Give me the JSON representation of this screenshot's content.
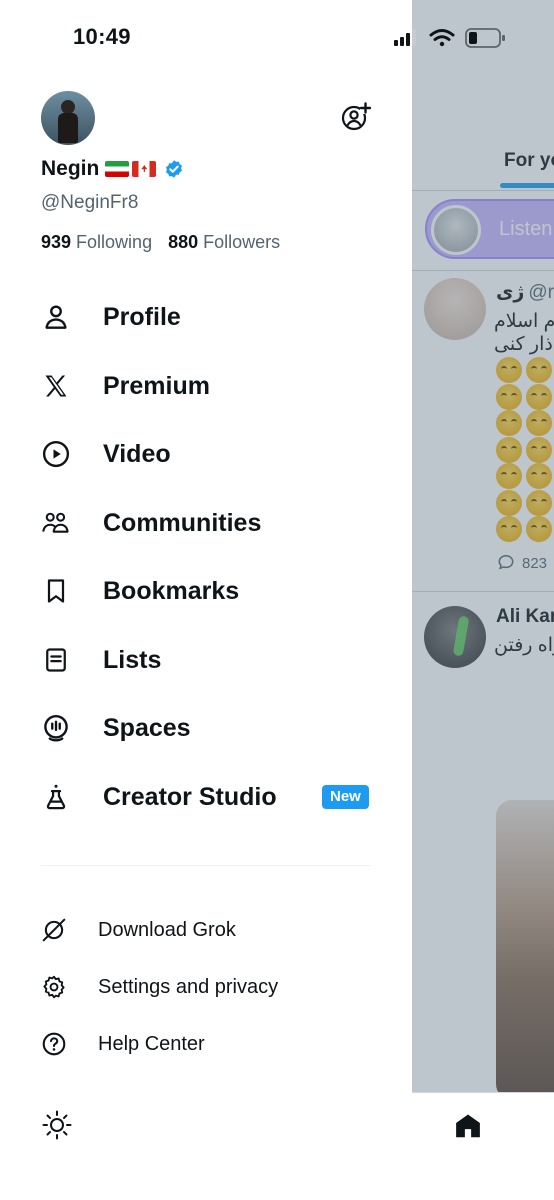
{
  "status_bar": {
    "time": "10:49"
  },
  "profile": {
    "name": "Negin",
    "handle": "@NeginFr8",
    "following_count": "939",
    "following_label": "Following",
    "followers_count": "880",
    "followers_label": "Followers"
  },
  "menu": [
    {
      "label": "Profile",
      "icon": "person-icon"
    },
    {
      "label": "Premium",
      "icon": "x-logo-icon"
    },
    {
      "label": "Video",
      "icon": "play-circle-icon"
    },
    {
      "label": "Communities",
      "icon": "communities-icon"
    },
    {
      "label": "Bookmarks",
      "icon": "bookmark-icon"
    },
    {
      "label": "Lists",
      "icon": "list-icon"
    },
    {
      "label": "Spaces",
      "icon": "microphone-icon"
    },
    {
      "label": "Creator Studio",
      "icon": "flask-icon",
      "badge": "New"
    }
  ],
  "secondary_menu": [
    {
      "label": "Download Grok",
      "icon": "grok-icon"
    },
    {
      "label": "Settings and privacy",
      "icon": "gear-icon"
    },
    {
      "label": "Help Center",
      "icon": "help-icon"
    }
  ],
  "theme_toggle_icon": "sun-icon",
  "background_feed": {
    "tab": "For yo",
    "listen_text": "Listen",
    "post1": {
      "name": "ژی",
      "handle": "@ro",
      "lines": [
        "م اسلام",
        "ذار کنی"
      ],
      "reply_count": "823"
    },
    "post2": {
      "name": "Ali Kar",
      "line": "راه رفتن"
    }
  },
  "colors": {
    "accent": "#1d9bf0",
    "text": "#0f1419",
    "secondary_text": "#536471",
    "overlay": "rgba(91,112,131,0.40)"
  }
}
